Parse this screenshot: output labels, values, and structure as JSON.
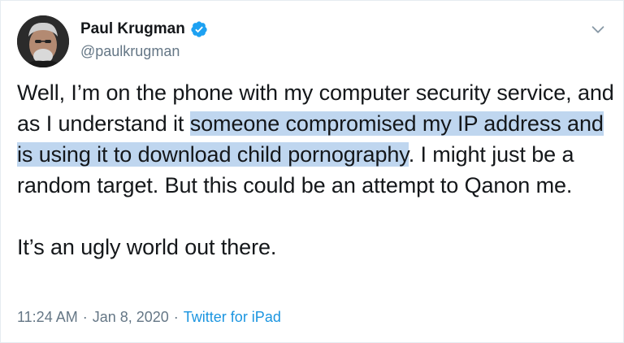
{
  "tweet": {
    "author": {
      "name": "Paul Krugman",
      "handle": "@paulkrugman",
      "verified_icon": "verified-badge-icon",
      "avatar_icon": "avatar"
    },
    "menu_icon": "chevron-down-icon",
    "text": {
      "line_a_plain": "Well, I’m on the phone with my computer security service, and as I understand it ",
      "line_a_highlight": "someone compromised my IP address and is using it to download child pornography",
      "line_a_rest": ". I might just be a random target. But this could be an attempt to Qanon me.",
      "line_b": "It’s an ugly world out there."
    },
    "meta": {
      "time": "11:24 AM",
      "date": "Jan 8, 2020",
      "separator": "·",
      "source": "Twitter for iPad"
    },
    "colors": {
      "accent": "#1b95e0",
      "highlight": "#bfd6ef",
      "muted": "#657786"
    }
  }
}
